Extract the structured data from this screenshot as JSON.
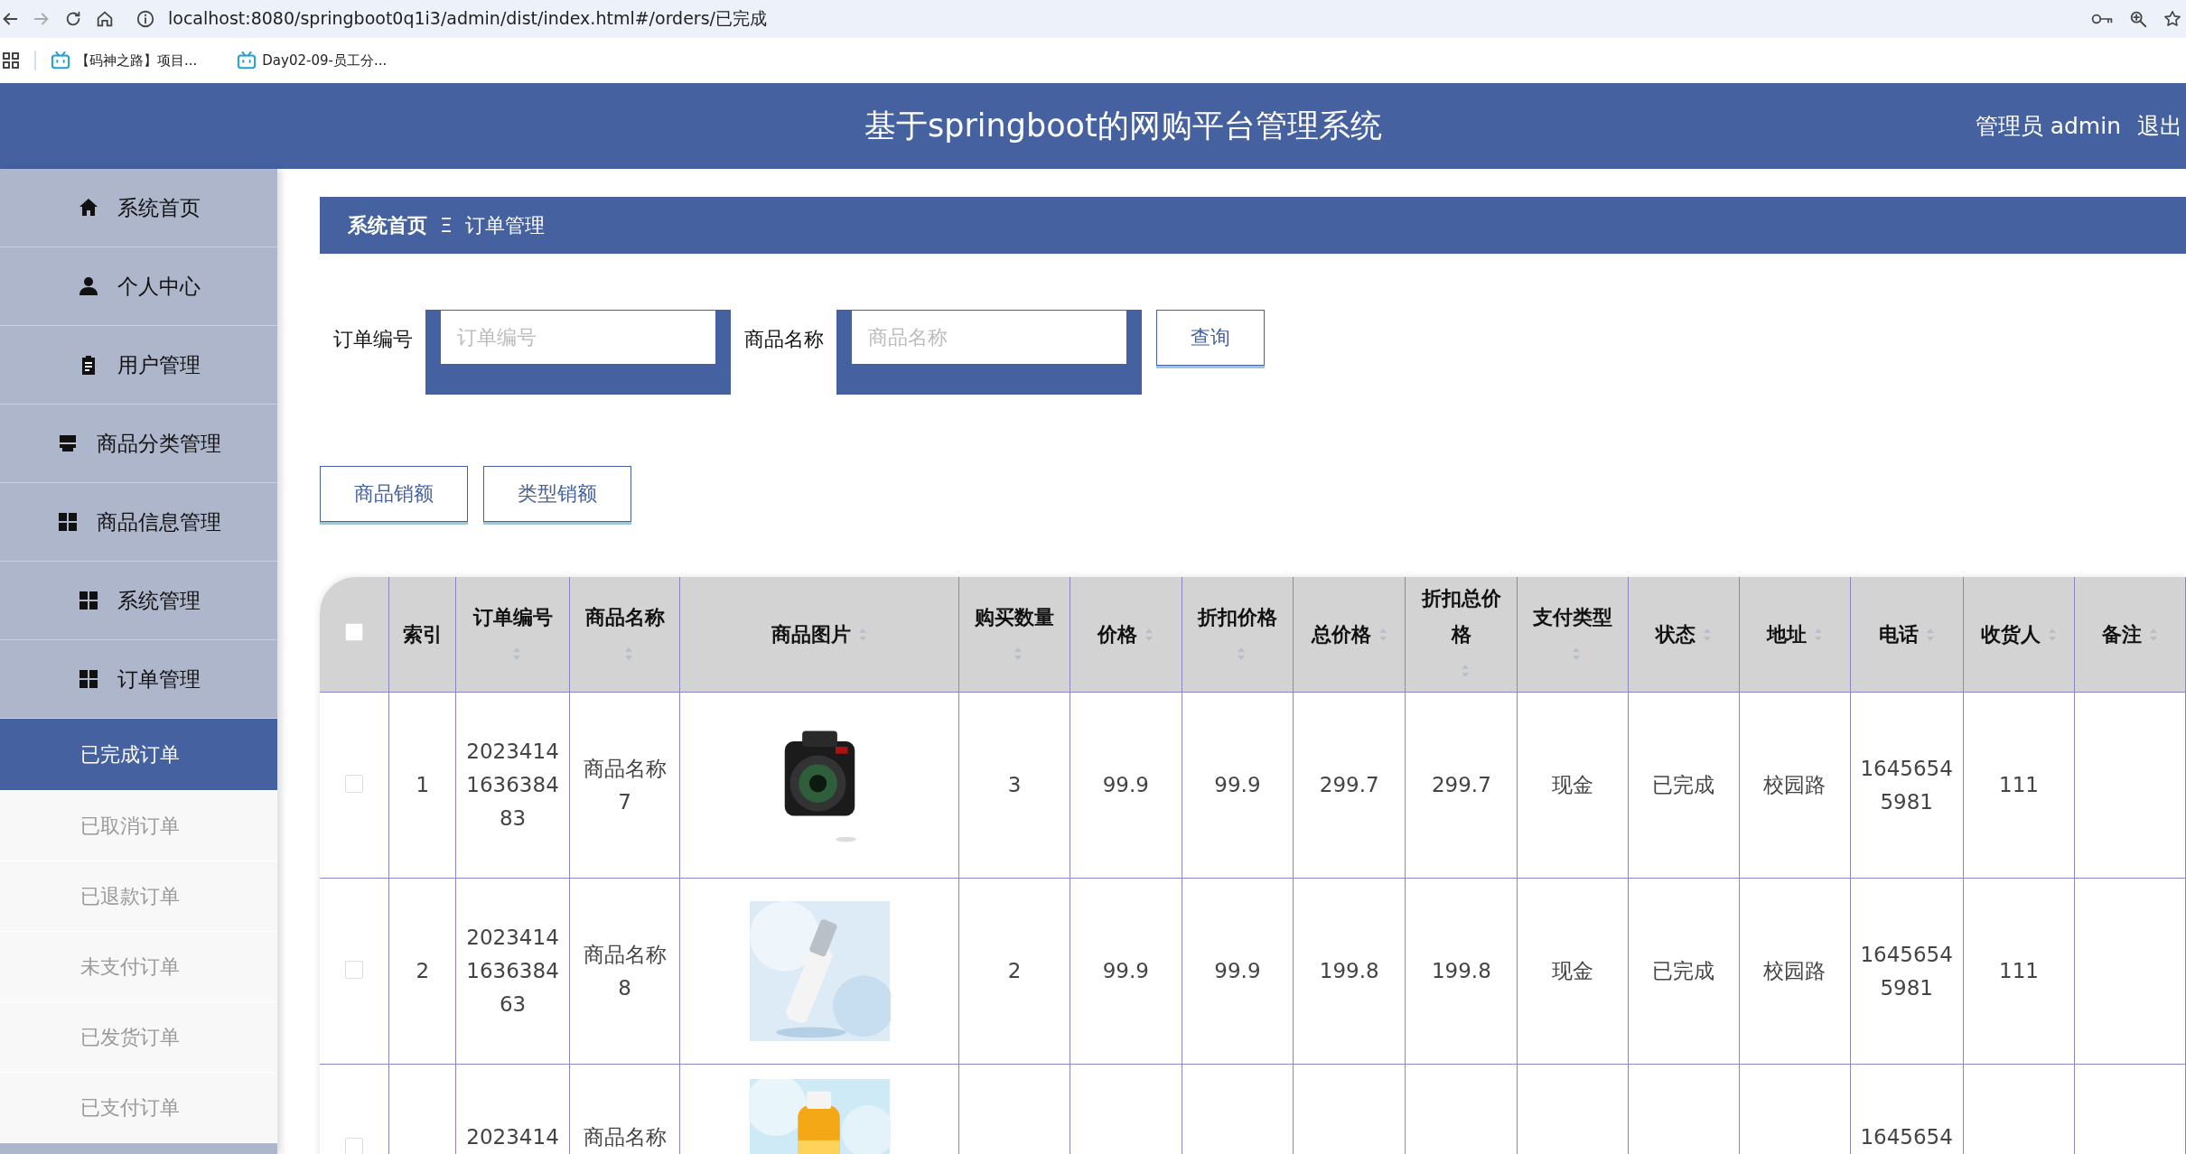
{
  "browser": {
    "url": "localhost:8080/springboot0q1i3/admin/dist/index.html#/orders/已完成",
    "bookmarks": [
      "【码神之路】项目...",
      "Day02-09-员工分..."
    ]
  },
  "header": {
    "title": "基于springboot的网购平台管理系统",
    "user": "管理员 admin",
    "logout": "退出"
  },
  "sidebar": {
    "items": [
      {
        "label": "系统首页",
        "selected": false
      },
      {
        "label": "个人中心",
        "selected": false
      },
      {
        "label": "用户管理",
        "selected": false
      },
      {
        "label": "商品分类管理",
        "selected": false
      },
      {
        "label": "商品信息管理",
        "selected": false
      },
      {
        "label": "系统管理",
        "selected": false
      },
      {
        "label": "订单管理",
        "selected": false,
        "expanded": true,
        "children": [
          {
            "label": "已完成订单",
            "selected": true
          },
          {
            "label": "已取消订单",
            "selected": false
          },
          {
            "label": "已退款订单",
            "selected": false
          },
          {
            "label": "未支付订单",
            "selected": false
          },
          {
            "label": "已发货订单",
            "selected": false
          },
          {
            "label": "已支付订单",
            "selected": false
          }
        ]
      }
    ]
  },
  "breadcrumb": {
    "items": [
      "系统首页",
      "订单管理"
    ],
    "separator": "Ξ"
  },
  "search": {
    "fields": [
      {
        "label": "订单编号",
        "placeholder": "订单编号"
      },
      {
        "label": "商品名称",
        "placeholder": "商品名称"
      }
    ],
    "button": "查询"
  },
  "action_buttons": [
    "商品销额",
    "类型销额"
  ],
  "table": {
    "header_checked": false,
    "columns": [
      {
        "label": "索引",
        "sortable": false
      },
      {
        "label": "订单编号",
        "sortable": true
      },
      {
        "label": "商品名称",
        "sortable": true
      },
      {
        "label": "商品图片",
        "sortable": true
      },
      {
        "label": "购买数量",
        "sortable": true
      },
      {
        "label": "价格",
        "sortable": true
      },
      {
        "label": "折扣价格",
        "sortable": true
      },
      {
        "label": "总价格",
        "sortable": true
      },
      {
        "label": "折扣总价格",
        "sortable": true
      },
      {
        "label": "支付类型",
        "sortable": true
      },
      {
        "label": "状态",
        "sortable": true
      },
      {
        "label": "地址",
        "sortable": true
      },
      {
        "label": "电话",
        "sortable": true
      },
      {
        "label": "收货人",
        "sortable": true
      },
      {
        "label": "备注",
        "sortable": true
      }
    ],
    "rows": [
      {
        "selected": false,
        "cells": [
          "1",
          "2023414163638483",
          "商品名称7",
          {
            "kind": "picture"
          },
          "3",
          "99.9",
          "99.9",
          "299.7",
          "299.7",
          "现金",
          "已完成",
          "校园路",
          "16456545981",
          "111",
          ""
        ]
      },
      {
        "selected": false,
        "cells": [
          "2",
          "2023414163638463",
          "商品名称8",
          {
            "kind": "picture"
          },
          "2",
          "99.9",
          "99.9",
          "199.8",
          "199.8",
          "现金",
          "已完成",
          "校园路",
          "16456545981",
          "111",
          ""
        ]
      },
      {
        "selected": false,
        "cells": [
          "",
          "2023414",
          "商品名称",
          {
            "kind": "picture"
          },
          "",
          "",
          "",
          "",
          "",
          "",
          "",
          "",
          "1645654",
          "",
          ""
        ]
      }
    ]
  }
}
